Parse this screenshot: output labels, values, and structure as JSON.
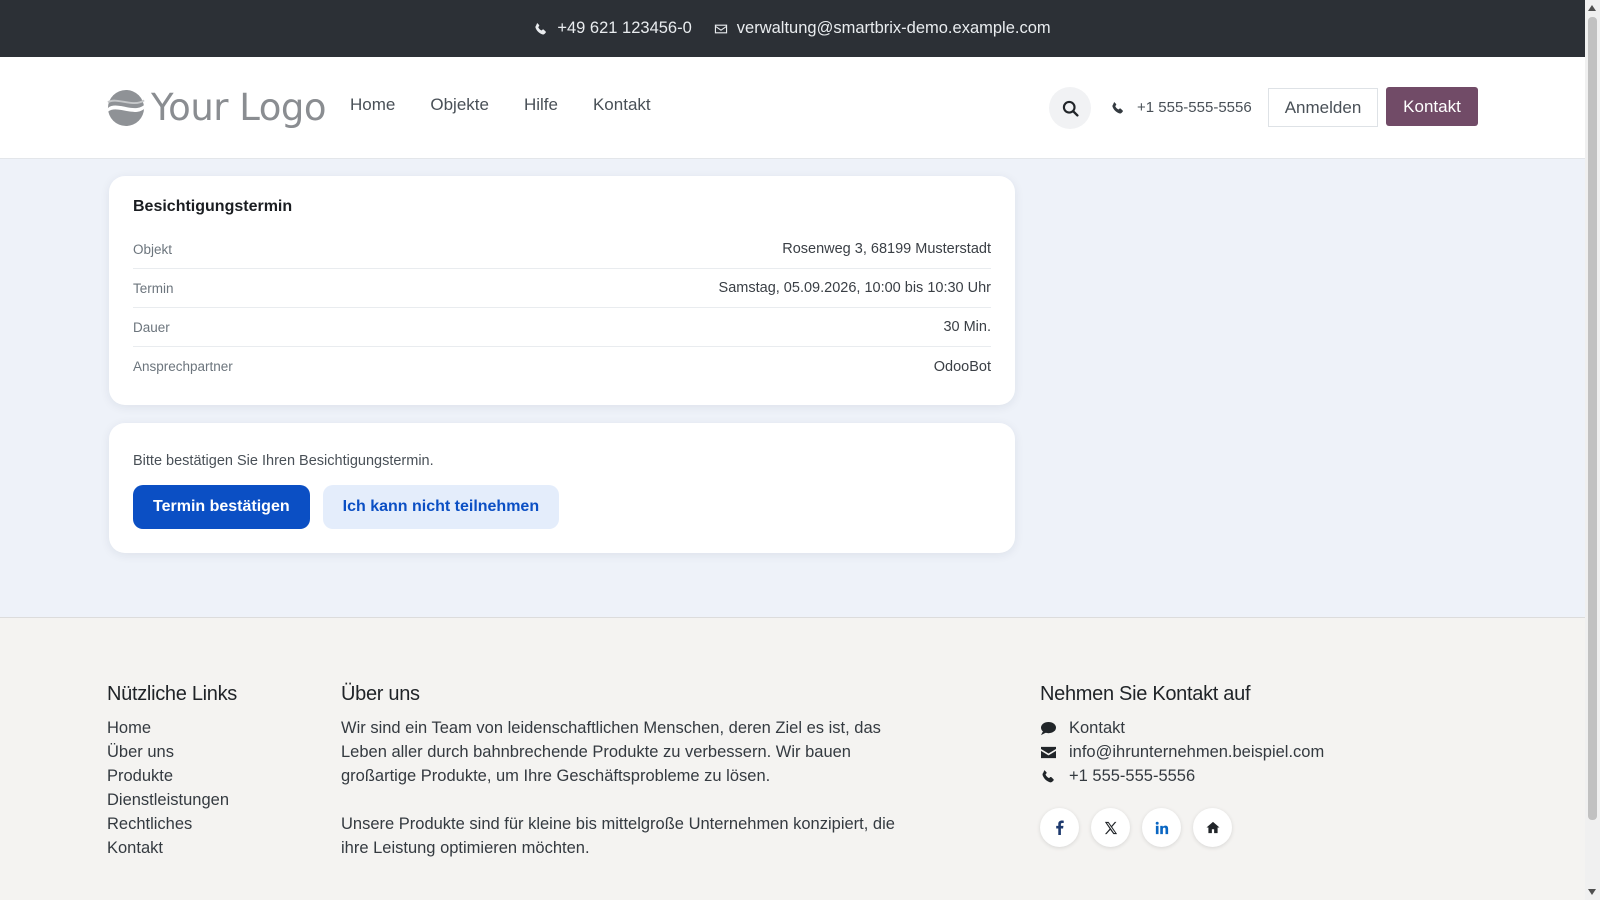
{
  "topbar": {
    "phone": "+49 621 123456-0",
    "email": "verwaltung@smartbrix-demo.example.com"
  },
  "navbar": {
    "logo_text": "Your Logo",
    "links": [
      "Home",
      "Objekte",
      "Hilfe",
      "Kontakt"
    ],
    "phone": "+1 555-555-5556",
    "login_label": "Anmelden",
    "contact_label": "Kontakt"
  },
  "appointment": {
    "title": "Besichtigungstermin",
    "rows": [
      {
        "label": "Objekt",
        "value": "Rosenweg 3, 68199 Musterstadt"
      },
      {
        "label": "Termin",
        "value": "Samstag, 05.09.2026, 10:00 bis 10:30 Uhr"
      },
      {
        "label": "Dauer",
        "value": "30 Min."
      },
      {
        "label": "Ansprechpartner",
        "value": "OdooBot"
      }
    ]
  },
  "confirm": {
    "message": "Bitte bestätigen Sie Ihren Besichtigungstermin.",
    "confirm_label": "Termin bestätigen",
    "decline_label": "Ich kann nicht teilnehmen"
  },
  "footer": {
    "links_title": "Nützliche Links",
    "links": [
      "Home",
      "Über uns",
      "Produkte",
      "Dienstleistungen",
      "Rechtliches",
      "Kontakt"
    ],
    "about_title": "Über uns",
    "about_p1": "Wir sind ein Team von leidenschaftlichen Menschen, deren Ziel es ist, das Leben aller durch bahnbrechende Produkte zu verbessern. Wir bauen großartige Produkte, um Ihre Geschäftsprobleme zu lösen.",
    "about_p2": "Unsere Produkte sind für kleine bis mittelgroße Unternehmen konzipiert, die ihre Leistung optimieren möchten.",
    "contact_title": "Nehmen Sie Kontakt auf",
    "contact_link": "Kontakt",
    "contact_email": "info@ihrunternehmen.beispiel.com",
    "contact_phone": "+1 555-555-5556",
    "socials": [
      "facebook-icon",
      "x-icon",
      "linkedin-icon",
      "home-icon"
    ]
  },
  "colors": {
    "brand_purple": "#714b67",
    "primary_blue": "#0b4fc4",
    "topbar_bg": "#2c3036"
  }
}
